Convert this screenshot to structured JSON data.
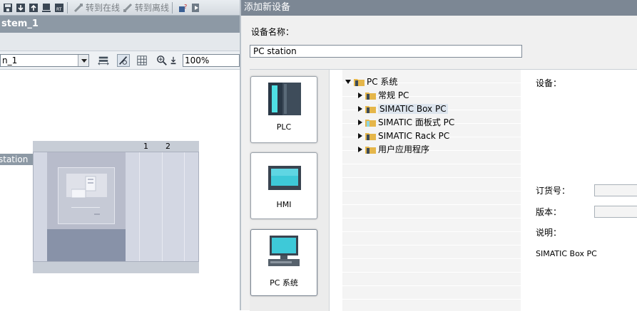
{
  "toolbar": {
    "go_online_label": "转到在线",
    "go_offline_label": "转到离线"
  },
  "editor": {
    "title": "stem_1",
    "device_select_value": "n_1",
    "zoom_value": "100%",
    "station_label": "station",
    "slot_numbers": [
      "1",
      "2"
    ]
  },
  "dialog": {
    "title": "添加新设备",
    "device_name_label": "设备名称：",
    "device_name_value": "PC station",
    "categories": [
      {
        "label": "PLC",
        "icon": "plc-icon"
      },
      {
        "label": "HMI",
        "icon": "hmi-icon"
      },
      {
        "label": "PC 系统",
        "icon": "pc-system-icon"
      }
    ],
    "tree": {
      "root": "PC 系统",
      "children": [
        "常规 PC",
        "SIMATIC Box PC",
        "SIMATIC 面板式 PC",
        "SIMATIC Rack PC",
        "用户应用程序"
      ],
      "selected": "SIMATIC Box PC"
    },
    "info": {
      "device_label": "设备：",
      "order_no_label": "订货号：",
      "version_label": "版本：",
      "description_label": "说明：",
      "description_value": "SIMATIC Box PC"
    }
  },
  "colors": {
    "title_bar": "#7c8794",
    "editor_strip": "#8d99a5",
    "rack": "#d3d7e3"
  }
}
